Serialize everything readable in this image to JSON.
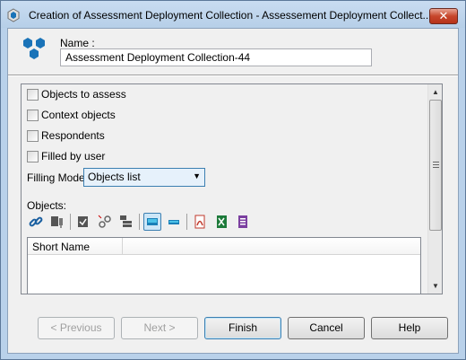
{
  "window": {
    "title": "Creation of Assessment Deployment Collection - Assessement Deployment Collect...",
    "close_label": "✕"
  },
  "form": {
    "name_label": "Name :",
    "name_value": "Assessment Deployment Collection-44"
  },
  "options": {
    "checkboxes": [
      {
        "label": "Objects to assess",
        "checked": false
      },
      {
        "label": "Context objects",
        "checked": false
      },
      {
        "label": "Respondents",
        "checked": false
      },
      {
        "label": "Filled by user",
        "checked": false
      }
    ],
    "filling_mode_label": "Filling Mode:",
    "filling_mode_value": "Objects list"
  },
  "objects": {
    "label": "Objects:",
    "toolbar_icons": [
      "link-icon",
      "move-icon",
      "check-doc-icon",
      "unlink-icon",
      "properties-icon",
      "view-mode-icon",
      "view-mode-compact-icon",
      "pdf-icon",
      "excel-icon",
      "report-icon"
    ],
    "columns": [
      "Short Name",
      ""
    ]
  },
  "buttons": {
    "previous": "< Previous",
    "next": "Next >",
    "finish": "Finish",
    "cancel": "Cancel",
    "help": "Help"
  },
  "colors": {
    "accent": "#3c7fb1",
    "logo": "#1a73b8"
  }
}
